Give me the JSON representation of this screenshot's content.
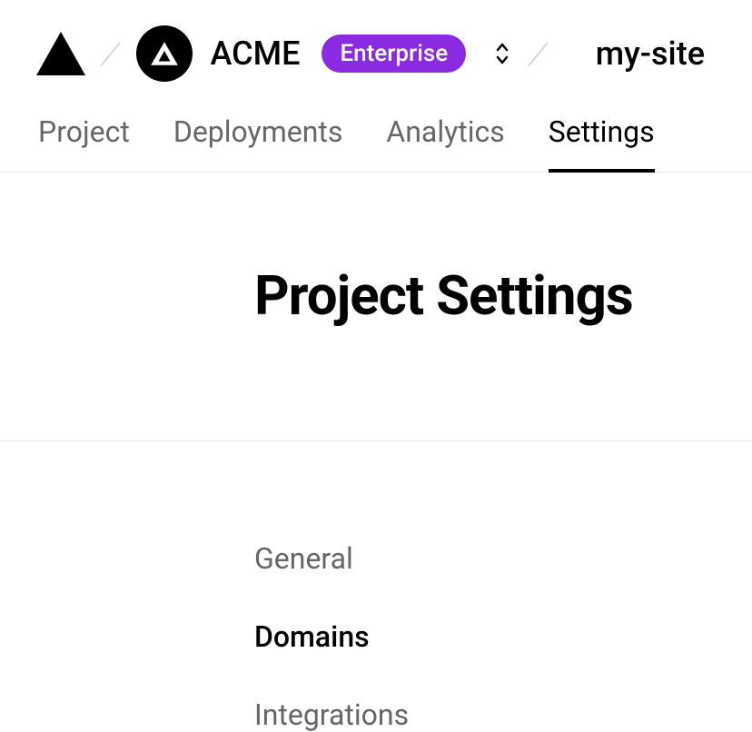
{
  "header": {
    "org_name": "ACME",
    "plan_badge": "Enterprise",
    "project_name": "my-site"
  },
  "tabs": [
    {
      "label": "Project",
      "active": false
    },
    {
      "label": "Deployments",
      "active": false
    },
    {
      "label": "Analytics",
      "active": false
    },
    {
      "label": "Settings",
      "active": true
    }
  ],
  "page_title": "Project Settings",
  "sidebar": {
    "items": [
      {
        "label": "General",
        "active": false
      },
      {
        "label": "Domains",
        "active": true
      },
      {
        "label": "Integrations",
        "active": false
      }
    ]
  }
}
